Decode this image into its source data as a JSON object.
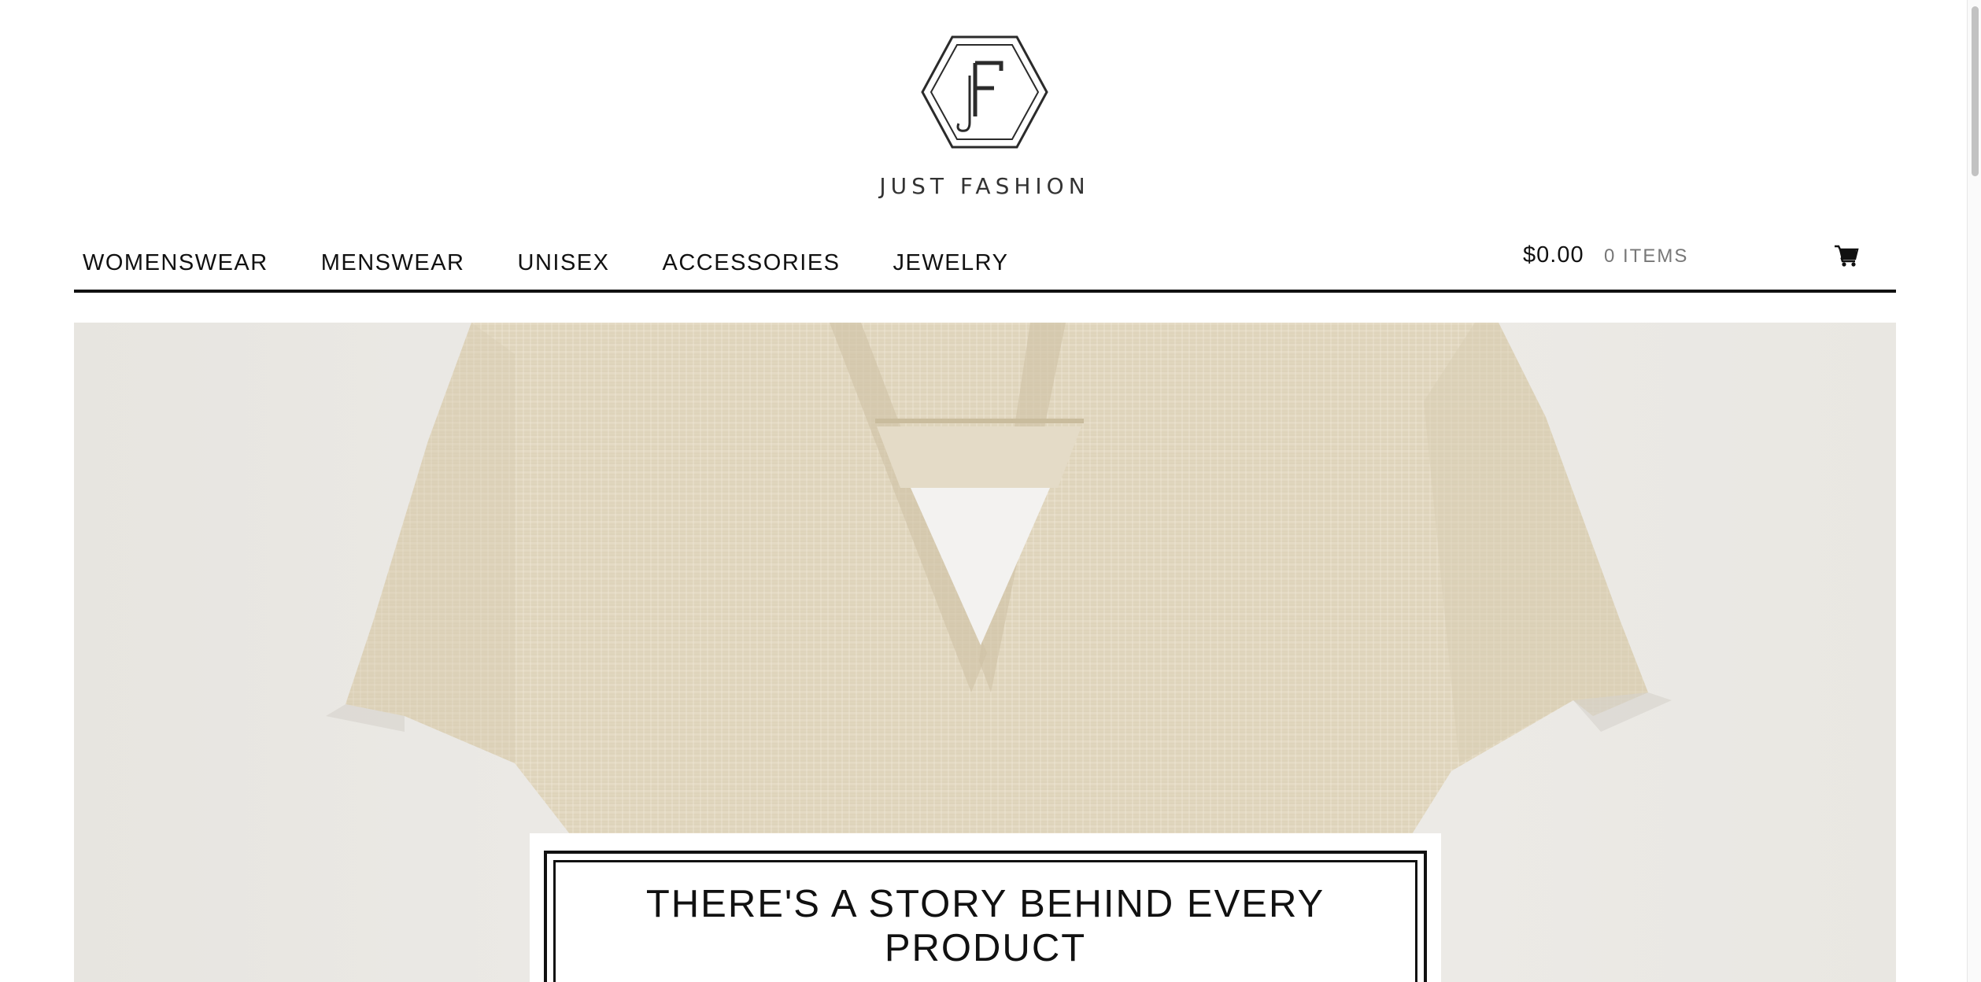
{
  "brand": {
    "monogram": "JF",
    "name": "JUST FASHION"
  },
  "nav": {
    "items": [
      {
        "label": "WOMENSWEAR"
      },
      {
        "label": "MENSWEAR"
      },
      {
        "label": "UNISEX"
      },
      {
        "label": "ACCESSORIES"
      },
      {
        "label": "JEWELRY"
      }
    ]
  },
  "cart": {
    "total": "$0.00",
    "items": "0 ITEMS",
    "icon": "shopping-cart-icon"
  },
  "hero": {
    "image": "cream-tweed-short-sleeve-top",
    "headline": "THERE'S A STORY BEHIND EVERY PRODUCT"
  },
  "colors": {
    "text": "#111111",
    "muted": "#777777",
    "background": "#ffffff",
    "fabric": "#e3dac5"
  }
}
